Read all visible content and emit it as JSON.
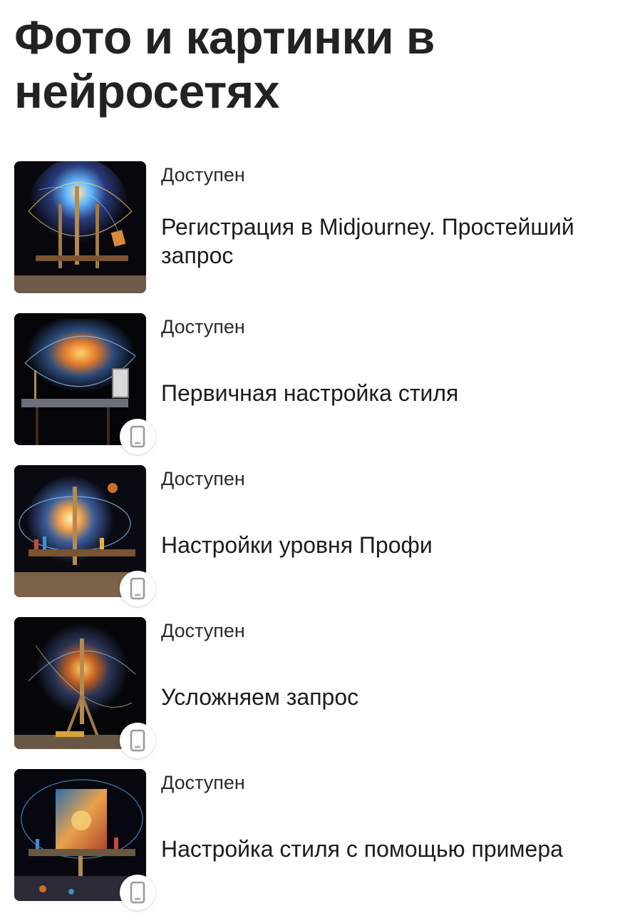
{
  "page": {
    "title": "Фото и картинки в нейросетях"
  },
  "lessons": [
    {
      "status": "Доступен",
      "title": "Регистрация в Midjourney. Простейший запрос",
      "device_icon": false
    },
    {
      "status": "Доступен",
      "title": "Первичная настройка стиля",
      "device_icon": true
    },
    {
      "status": "Доступен",
      "title": "Настройки уровня Профи",
      "device_icon": true
    },
    {
      "status": "Доступен",
      "title": "Усложняем запрос",
      "device_icon": true
    },
    {
      "status": "Доступен",
      "title": "Настройка стиля с помощью примера",
      "device_icon": true
    }
  ],
  "icons": {
    "device": "smartphone-icon"
  },
  "colors": {
    "text": "#1c1c1e",
    "background": "#ffffff",
    "icon_gray": "#9a9a9a"
  }
}
